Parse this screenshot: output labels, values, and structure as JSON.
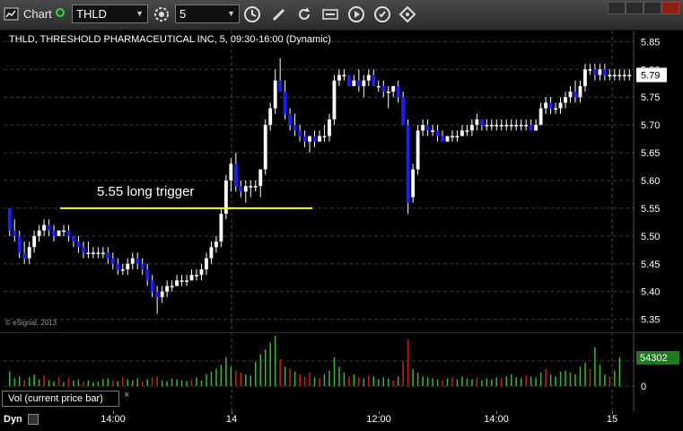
{
  "toolbar": {
    "app_label": "Chart",
    "symbol": "THLD",
    "interval": "5",
    "icons": [
      "chart-icon",
      "link-icon",
      "symbol-dropdown",
      "gear-icon",
      "interval-dropdown",
      "time-icon",
      "pencil-icon",
      "refresh-icon",
      "ticker-icon",
      "play-icon",
      "settings-icon"
    ]
  },
  "chart": {
    "title": "THLD, THRESHOLD PHARMACEUTICAL INC, 5, 09:30-16:00 (Dynamic)",
    "copyright": "© eSignal, 2013",
    "annotation": "5.55 long trigger",
    "trigger_price": 5.55,
    "last_price_label": "5.79",
    "volume_label_value": "54302",
    "colors": {
      "up": "#ffffff",
      "down": "#1d1dff",
      "grid": "#3a3a3a",
      "trigger": "#ffff00",
      "vol_up": "#38b838",
      "vol_down": "#c82020",
      "last_price_bg": "#ffffff",
      "vol_badge_bg": "#1f7a1f"
    }
  },
  "panels": {
    "volume_study_label": "Vol (current price bar)",
    "close_symbol": "×",
    "dyn_label": "Dyn"
  },
  "chart_data": {
    "type": "candlestick",
    "price_axis": {
      "ticks": [
        "5.85",
        "5.80",
        "5.75",
        "5.70",
        "5.65",
        "5.60",
        "5.55",
        "5.50",
        "5.45",
        "5.40",
        "5.35"
      ],
      "range": [
        5.33,
        5.87
      ]
    },
    "volume_axis": {
      "ticks": [
        "0"
      ]
    },
    "x_ticks": [
      "14:00",
      "14",
      "12:00",
      "14:00",
      "15"
    ],
    "series": [
      {
        "name": "price",
        "ohlc": [
          [
            5.55,
            5.55,
            5.5,
            5.51
          ],
          [
            5.51,
            5.53,
            5.49,
            5.5
          ],
          [
            5.5,
            5.51,
            5.46,
            5.47
          ],
          [
            5.47,
            5.49,
            5.45,
            5.46
          ],
          [
            5.46,
            5.49,
            5.45,
            5.48
          ],
          [
            5.48,
            5.51,
            5.47,
            5.5
          ],
          [
            5.5,
            5.52,
            5.49,
            5.51
          ],
          [
            5.51,
            5.53,
            5.5,
            5.52
          ],
          [
            5.52,
            5.53,
            5.5,
            5.51
          ],
          [
            5.51,
            5.52,
            5.49,
            5.5
          ],
          [
            5.5,
            5.51,
            5.5,
            5.51
          ],
          [
            5.51,
            5.52,
            5.5,
            5.51
          ],
          [
            5.51,
            5.52,
            5.49,
            5.5
          ],
          [
            5.5,
            5.5,
            5.48,
            5.49
          ],
          [
            5.49,
            5.5,
            5.47,
            5.48
          ],
          [
            5.48,
            5.49,
            5.46,
            5.47
          ],
          [
            5.47,
            5.49,
            5.46,
            5.47
          ],
          [
            5.47,
            5.48,
            5.46,
            5.47
          ],
          [
            5.47,
            5.48,
            5.46,
            5.47
          ],
          [
            5.47,
            5.48,
            5.46,
            5.47
          ],
          [
            5.47,
            5.48,
            5.45,
            5.46
          ],
          [
            5.46,
            5.47,
            5.44,
            5.45
          ],
          [
            5.45,
            5.46,
            5.43,
            5.44
          ],
          [
            5.44,
            5.45,
            5.43,
            5.44
          ],
          [
            5.44,
            5.46,
            5.43,
            5.45
          ],
          [
            5.45,
            5.47,
            5.44,
            5.46
          ],
          [
            5.46,
            5.47,
            5.44,
            5.45
          ],
          [
            5.45,
            5.46,
            5.43,
            5.44
          ],
          [
            5.44,
            5.45,
            5.41,
            5.42
          ],
          [
            5.42,
            5.43,
            5.39,
            5.4
          ],
          [
            5.4,
            5.41,
            5.36,
            5.39
          ],
          [
            5.39,
            5.41,
            5.38,
            5.4
          ],
          [
            5.4,
            5.42,
            5.39,
            5.41
          ],
          [
            5.41,
            5.42,
            5.4,
            5.41
          ],
          [
            5.41,
            5.43,
            5.41,
            5.42
          ],
          [
            5.42,
            5.43,
            5.41,
            5.42
          ],
          [
            5.42,
            5.43,
            5.41,
            5.42
          ],
          [
            5.42,
            5.44,
            5.42,
            5.43
          ],
          [
            5.43,
            5.44,
            5.42,
            5.43
          ],
          [
            5.43,
            5.45,
            5.42,
            5.44
          ],
          [
            5.44,
            5.47,
            5.43,
            5.46
          ],
          [
            5.46,
            5.49,
            5.45,
            5.48
          ],
          [
            5.48,
            5.5,
            5.47,
            5.49
          ],
          [
            5.49,
            5.55,
            5.48,
            5.54
          ],
          [
            5.54,
            5.61,
            5.53,
            5.6
          ],
          [
            5.6,
            5.64,
            5.58,
            5.63
          ],
          [
            5.63,
            5.65,
            5.58,
            5.59
          ],
          [
            5.59,
            5.6,
            5.57,
            5.58
          ],
          [
            5.58,
            5.6,
            5.56,
            5.59
          ],
          [
            5.59,
            5.6,
            5.57,
            5.59
          ],
          [
            5.59,
            5.6,
            5.58,
            5.59
          ],
          [
            5.59,
            5.62,
            5.57,
            5.62
          ],
          [
            5.62,
            5.71,
            5.61,
            5.7
          ],
          [
            5.7,
            5.74,
            5.69,
            5.73
          ],
          [
            5.73,
            5.8,
            5.72,
            5.78
          ],
          [
            5.78,
            5.82,
            5.76,
            5.76
          ],
          [
            5.76,
            5.78,
            5.71,
            5.72
          ],
          [
            5.72,
            5.73,
            5.69,
            5.7
          ],
          [
            5.7,
            5.72,
            5.68,
            5.69
          ],
          [
            5.69,
            5.7,
            5.67,
            5.68
          ],
          [
            5.68,
            5.69,
            5.66,
            5.67
          ],
          [
            5.67,
            5.68,
            5.65,
            5.68
          ],
          [
            5.68,
            5.69,
            5.66,
            5.67
          ],
          [
            5.67,
            5.69,
            5.67,
            5.68
          ],
          [
            5.68,
            5.7,
            5.67,
            5.68
          ],
          [
            5.68,
            5.72,
            5.67,
            5.71
          ],
          [
            5.71,
            5.79,
            5.7,
            5.78
          ],
          [
            5.78,
            5.8,
            5.77,
            5.79
          ],
          [
            5.79,
            5.8,
            5.78,
            5.79
          ],
          [
            5.79,
            5.79,
            5.77,
            5.77
          ],
          [
            5.77,
            5.79,
            5.77,
            5.78
          ],
          [
            5.78,
            5.8,
            5.76,
            5.77
          ],
          [
            5.77,
            5.79,
            5.75,
            5.78
          ],
          [
            5.78,
            5.8,
            5.77,
            5.79
          ],
          [
            5.79,
            5.8,
            5.77,
            5.77
          ],
          [
            5.77,
            5.78,
            5.76,
            5.77
          ],
          [
            5.77,
            5.78,
            5.75,
            5.76
          ],
          [
            5.76,
            5.77,
            5.73,
            5.76
          ],
          [
            5.76,
            5.77,
            5.75,
            5.77
          ],
          [
            5.77,
            5.78,
            5.74,
            5.75
          ],
          [
            5.75,
            5.76,
            5.7,
            5.7
          ],
          [
            5.7,
            5.71,
            5.54,
            5.56
          ],
          [
            5.57,
            5.63,
            5.56,
            5.62
          ],
          [
            5.62,
            5.7,
            5.61,
            5.69
          ],
          [
            5.69,
            5.71,
            5.68,
            5.7
          ],
          [
            5.7,
            5.71,
            5.68,
            5.69
          ],
          [
            5.69,
            5.7,
            5.68,
            5.69
          ],
          [
            5.69,
            5.7,
            5.67,
            5.68
          ],
          [
            5.68,
            5.69,
            5.67,
            5.67
          ],
          [
            5.67,
            5.68,
            5.67,
            5.68
          ],
          [
            5.68,
            5.69,
            5.67,
            5.68
          ],
          [
            5.68,
            5.69,
            5.67,
            5.68
          ],
          [
            5.68,
            5.7,
            5.68,
            5.69
          ],
          [
            5.69,
            5.7,
            5.68,
            5.69
          ],
          [
            5.69,
            5.71,
            5.68,
            5.7
          ],
          [
            5.7,
            5.72,
            5.69,
            5.71
          ],
          [
            5.71,
            5.71,
            5.69,
            5.7
          ],
          [
            5.7,
            5.71,
            5.69,
            5.7
          ],
          [
            5.7,
            5.71,
            5.69,
            5.7
          ],
          [
            5.7,
            5.71,
            5.69,
            5.7
          ],
          [
            5.7,
            5.71,
            5.69,
            5.7
          ],
          [
            5.7,
            5.71,
            5.69,
            5.7
          ],
          [
            5.7,
            5.71,
            5.69,
            5.7
          ],
          [
            5.7,
            5.71,
            5.69,
            5.7
          ],
          [
            5.7,
            5.71,
            5.69,
            5.7
          ],
          [
            5.7,
            5.71,
            5.69,
            5.7
          ],
          [
            5.7,
            5.71,
            5.69,
            5.69
          ],
          [
            5.69,
            5.71,
            5.69,
            5.7
          ],
          [
            5.7,
            5.74,
            5.7,
            5.73
          ],
          [
            5.73,
            5.75,
            5.72,
            5.74
          ],
          [
            5.74,
            5.75,
            5.72,
            5.73
          ],
          [
            5.73,
            5.74,
            5.72,
            5.73
          ],
          [
            5.73,
            5.75,
            5.72,
            5.74
          ],
          [
            5.74,
            5.76,
            5.73,
            5.75
          ],
          [
            5.75,
            5.77,
            5.74,
            5.76
          ],
          [
            5.76,
            5.78,
            5.74,
            5.75
          ],
          [
            5.75,
            5.78,
            5.74,
            5.77
          ],
          [
            5.77,
            5.81,
            5.76,
            5.8
          ],
          [
            5.8,
            5.81,
            5.79,
            5.8
          ],
          [
            5.8,
            5.81,
            5.78,
            5.79
          ],
          [
            5.79,
            5.81,
            5.78,
            5.8
          ],
          [
            5.8,
            5.81,
            5.78,
            5.79
          ],
          [
            5.79,
            5.8,
            5.78,
            5.79
          ],
          [
            5.79,
            5.8,
            5.78,
            5.79
          ],
          [
            5.79,
            5.8,
            5.78,
            5.79
          ],
          [
            5.79,
            5.8,
            5.78,
            5.79
          ],
          [
            5.79,
            5.8,
            5.78,
            5.79
          ]
        ]
      },
      {
        "name": "volume",
        "values": [
          15,
          8,
          10,
          6,
          9,
          12,
          7,
          11,
          6,
          5,
          9,
          4,
          8,
          6,
          7,
          5,
          6,
          4,
          5,
          7,
          8,
          6,
          5,
          9,
          7,
          6,
          8,
          5,
          7,
          9,
          10,
          6,
          5,
          8,
          7,
          6,
          5,
          7,
          9,
          6,
          12,
          15,
          18,
          22,
          30,
          20,
          16,
          14,
          12,
          11,
          25,
          33,
          38,
          45,
          52,
          28,
          20,
          18,
          15,
          12,
          10,
          14,
          9,
          8,
          12,
          16,
          30,
          20,
          14,
          10,
          12,
          9,
          8,
          11,
          10,
          7,
          9,
          8,
          6,
          10,
          26,
          48,
          18,
          14,
          10,
          9,
          8,
          7,
          6,
          8,
          9,
          7,
          10,
          8,
          7,
          9,
          6,
          8,
          7,
          9,
          8,
          10,
          12,
          9,
          8,
          11,
          10,
          9,
          14,
          18,
          12,
          10,
          15,
          16,
          14,
          12,
          20,
          24,
          18,
          40,
          22,
          12,
          10,
          16,
          30
        ],
        "down": [
          3,
          7,
          10,
          12,
          15,
          21,
          23,
          27,
          29,
          30,
          37,
          46,
          47,
          55,
          57,
          59,
          60,
          61,
          63,
          69,
          71,
          73,
          78,
          80,
          81,
          88,
          90,
          95,
          100,
          105,
          109,
          118,
          122,
          125,
          128
        ]
      }
    ]
  }
}
